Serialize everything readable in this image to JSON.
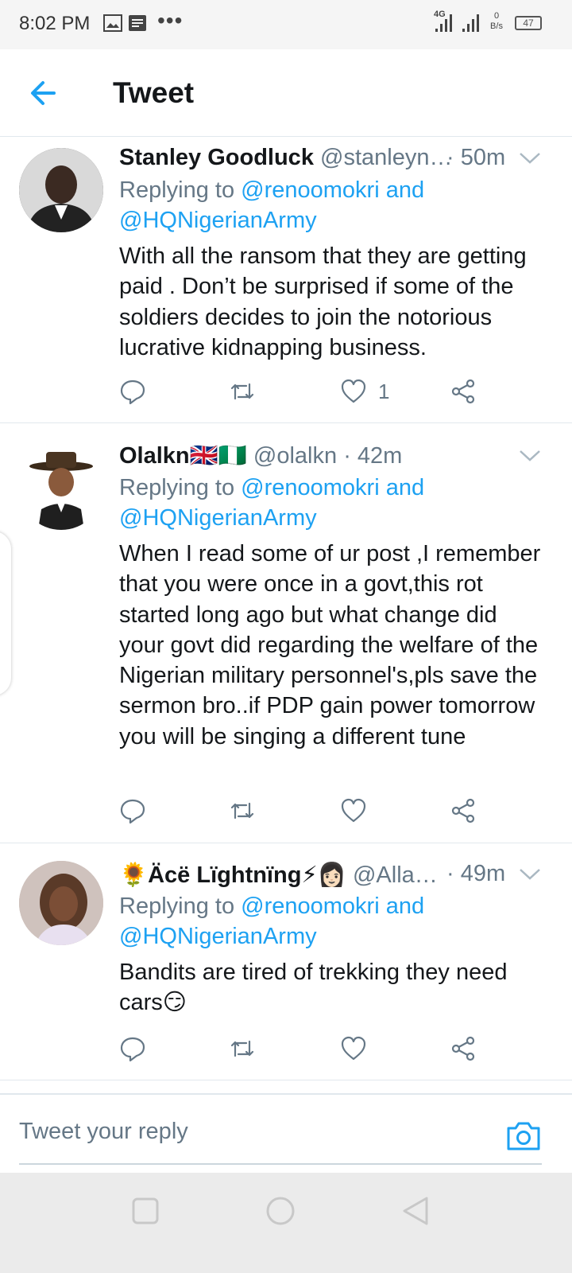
{
  "status_bar": {
    "time": "8:02 PM",
    "network_type": "4G",
    "net_speed_value": "0",
    "net_speed_unit": "B/s",
    "battery": "47",
    "icons": [
      "gallery-icon",
      "document-icon",
      "more-dots-icon",
      "signal-icon",
      "battery-icon"
    ]
  },
  "header": {
    "title": "Tweet",
    "back_icon": "arrow-left-icon"
  },
  "tweets": [
    {
      "author": "Stanley Goodluck",
      "handle": "@stanleyn…",
      "time": "· 50m",
      "replying_prefix": "Replying to ",
      "replying_user1": "@renoomokri",
      "replying_and": " and",
      "replying_user2": "@HQNigerianArmy",
      "text": "With all the ransom that they are getting paid . Don’t be surprised if some of the soldiers decides to join the notorious lucrative kidnapping business.",
      "likes": "1"
    },
    {
      "author": "Olalkn🇬🇧🇳🇬",
      "handle": "@olalkn",
      "time": "· 42m",
      "replying_prefix": "Replying to ",
      "replying_user1": "@renoomokri",
      "replying_and": " and",
      "replying_user2": "@HQNigerianArmy",
      "text": "When I read some of ur post ,I remember that you were once in a govt,this rot started long ago but what change did your govt did regarding the welfare of the Nigerian military personnel's,pls save the sermon bro..if PDP gain power tomorrow you will be singing a different tune",
      "likes": ""
    },
    {
      "author": "🌻Äcë Lïghtnïng⚡👩🏻",
      "handle": "@Alla…",
      "time": "· 49m",
      "replying_prefix": "Replying to ",
      "replying_user1": "@renoomokri",
      "replying_and": " and",
      "replying_user2": "@HQNigerianArmy",
      "text": "Bandits are tired of trekking they need cars😏",
      "likes": ""
    }
  ],
  "reply_bar": {
    "placeholder": "Tweet your reply",
    "camera_icon": "camera-icon"
  },
  "colors": {
    "accent": "#1da1f2",
    "secondary_text": "#657786",
    "divider": "#e1e8ed"
  }
}
